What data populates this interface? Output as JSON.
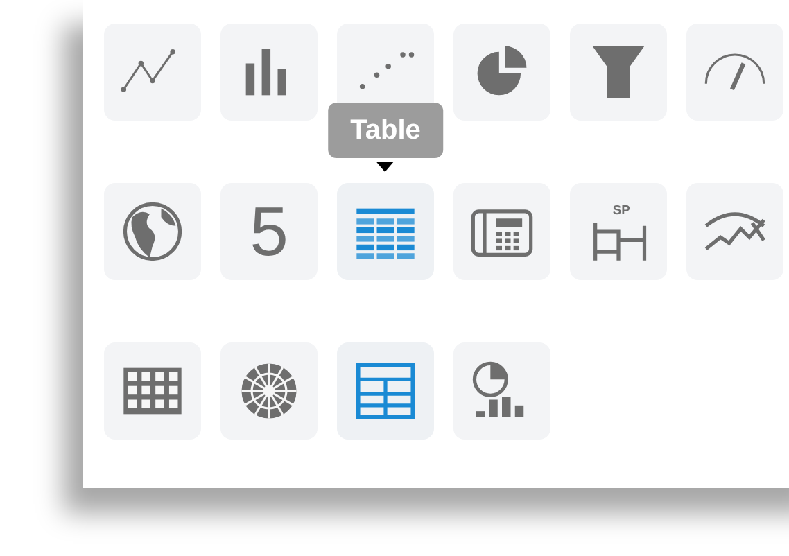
{
  "chart_types": [
    {
      "kind": "line",
      "highlighted": false
    },
    {
      "kind": "bar",
      "highlighted": false
    },
    {
      "kind": "scatter",
      "highlighted": false
    },
    {
      "kind": "pie",
      "highlighted": false
    },
    {
      "kind": "funnel",
      "highlighted": false
    },
    {
      "kind": "gauge",
      "highlighted": false
    },
    {
      "kind": "globe",
      "highlighted": false
    },
    {
      "kind": "number",
      "highlighted": false,
      "label": "5"
    },
    {
      "kind": "table",
      "highlighted": true,
      "tooltip": "Table"
    },
    {
      "kind": "calculator",
      "highlighted": false
    },
    {
      "kind": "sp",
      "highlighted": false,
      "label": "SP"
    },
    {
      "kind": "wave",
      "highlighted": false
    },
    {
      "kind": "grid",
      "highlighted": false
    },
    {
      "kind": "sunburst",
      "highlighted": false
    },
    {
      "kind": "layout",
      "highlighted": true
    },
    {
      "kind": "piebar",
      "highlighted": false
    }
  ]
}
